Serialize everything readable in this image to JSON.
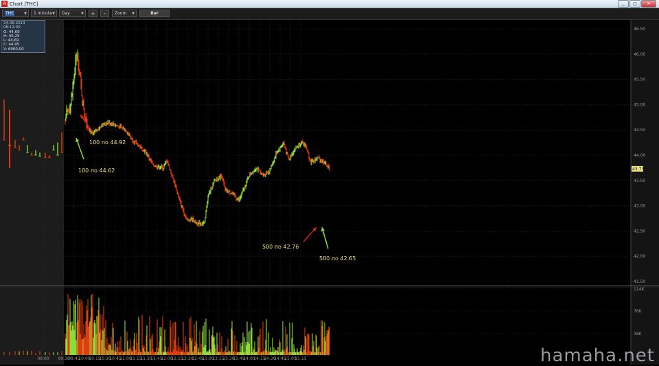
{
  "window": {
    "title": "Chart [THC]",
    "app_icon_label": "A",
    "buttons": [
      "_",
      "□",
      "✕"
    ]
  },
  "toolbar": {
    "symbol": "THC",
    "interval": "1 minute",
    "range": "Day",
    "plus": "+",
    "minus": "-",
    "zoom": "Zoom",
    "bar": "Bar"
  },
  "ohlc_box": {
    "date": "24.06.2013 08:12:00",
    "open": "O: 44,69",
    "high": "H: 45,25",
    "low": "L: 44,69",
    "close": "C: 44,95",
    "volume": "V: 6900,00"
  },
  "annotations": [
    {
      "text": "100 по 44.92",
      "color": "#d42020"
    },
    {
      "text": "100 по 44.62",
      "color": "#8cdc3c"
    },
    {
      "text": "500 по 42.76",
      "color": "#d42020"
    },
    {
      "text": "500 по 42.65",
      "color": "#8cdc3c"
    }
  ],
  "watermark": "hamaha.net",
  "colors": {
    "up": "#8cdc3c",
    "down": "#e03c10",
    "grid": "#333333",
    "premarket_bg": "#1c1c1c",
    "last_price_badge": "#f0e68c"
  },
  "chart_data": {
    "type": "bar",
    "price_axis": {
      "ticks": [
        "46.50",
        "46.00",
        "45.50",
        "45.00",
        "44.50",
        "44.00",
        "43.50",
        "43.00",
        "42.50",
        "42.00",
        "41.50"
      ],
      "ylim": [
        41.5,
        46.5
      ]
    },
    "last_price_label": "43.73",
    "volume_axis": {
      "ticks": [
        "114K",
        "76K",
        "38K"
      ]
    },
    "time_ticks": [
      "09:00",
      "09:30",
      "09:45",
      "10:00",
      "10:15",
      "10:30",
      "10:45",
      "11:00",
      "11:15",
      "11:30",
      "11:45",
      "12:00",
      "12:15",
      "12:30",
      "12:45",
      "13:00",
      "13:15",
      "13:30",
      "13:45",
      "14:00",
      "14:15",
      "14:30",
      "14:45",
      "15:00",
      "15:15"
    ],
    "price_path": [
      [
        "09:32",
        44.7
      ],
      [
        "09:40",
        45.0
      ],
      [
        "09:48",
        45.9
      ],
      [
        "09:50",
        45.95
      ],
      [
        "09:58",
        45.0
      ],
      [
        "10:05",
        44.55
      ],
      [
        "10:12",
        44.4
      ],
      [
        "10:15",
        44.45
      ],
      [
        "10:25",
        44.6
      ],
      [
        "10:35",
        44.65
      ],
      [
        "10:45",
        44.6
      ],
      [
        "11:00",
        44.5
      ],
      [
        "11:10",
        44.3
      ],
      [
        "11:30",
        44.05
      ],
      [
        "11:40",
        43.8
      ],
      [
        "11:55",
        43.75
      ],
      [
        "12:00",
        43.9
      ],
      [
        "12:10",
        43.5
      ],
      [
        "12:20",
        43.05
      ],
      [
        "12:30",
        42.7
      ],
      [
        "12:35",
        42.75
      ],
      [
        "12:45",
        42.65
      ],
      [
        "12:55",
        42.65
      ],
      [
        "13:00",
        43.2
      ],
      [
        "13:10",
        43.5
      ],
      [
        "13:20",
        43.6
      ],
      [
        "13:25",
        43.3
      ],
      [
        "13:35",
        43.25
      ],
      [
        "13:45",
        43.1
      ],
      [
        "14:00",
        43.6
      ],
      [
        "14:10",
        43.75
      ],
      [
        "14:20",
        43.6
      ],
      [
        "14:30",
        43.7
      ],
      [
        "14:40",
        44.05
      ],
      [
        "14:50",
        44.25
      ],
      [
        "14:58",
        43.9
      ],
      [
        "15:05",
        44.1
      ],
      [
        "15:15",
        44.25
      ],
      [
        "15:22",
        44.2
      ],
      [
        "15:30",
        43.85
      ],
      [
        "15:40",
        43.95
      ],
      [
        "15:50",
        43.85
      ],
      [
        "15:57",
        43.73
      ]
    ]
  }
}
